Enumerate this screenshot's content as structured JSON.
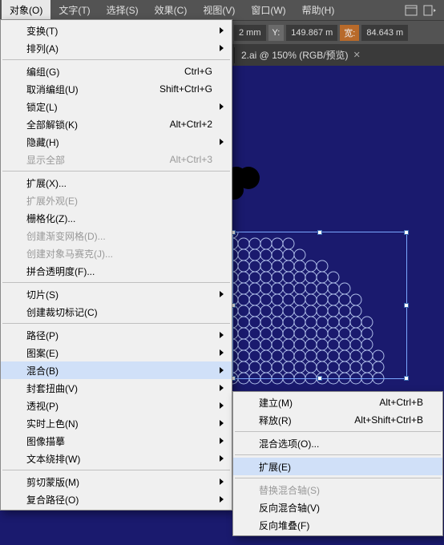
{
  "menubar": {
    "items": [
      "对象(O)",
      "文字(T)",
      "选择(S)",
      "效果(C)",
      "视图(V)",
      "窗口(W)",
      "帮助(H)"
    ]
  },
  "options": {
    "x_suffix": "2 mm",
    "y_label": "Y:",
    "y_value": "149.867 m",
    "w_label": "宽:",
    "w_value": "84.643 m"
  },
  "tab": {
    "title": "2.ai @ 150% (RGB/预览)"
  },
  "main_menu": [
    {
      "label": "变换(T)",
      "sub": true
    },
    {
      "label": "排列(A)",
      "sub": true
    },
    {
      "sep": true
    },
    {
      "label": "编组(G)",
      "shortcut": "Ctrl+G"
    },
    {
      "label": "取消编组(U)",
      "shortcut": "Shift+Ctrl+G"
    },
    {
      "label": "锁定(L)",
      "sub": true
    },
    {
      "label": "全部解锁(K)",
      "shortcut": "Alt+Ctrl+2"
    },
    {
      "label": "隐藏(H)",
      "sub": true
    },
    {
      "label": "显示全部",
      "shortcut": "Alt+Ctrl+3",
      "disabled": true
    },
    {
      "sep": true
    },
    {
      "label": "扩展(X)..."
    },
    {
      "label": "扩展外观(E)",
      "disabled": true
    },
    {
      "label": "栅格化(Z)..."
    },
    {
      "label": "创建渐变网格(D)...",
      "disabled": true
    },
    {
      "label": "创建对象马赛克(J)...",
      "disabled": true
    },
    {
      "label": "拼合透明度(F)..."
    },
    {
      "sep": true
    },
    {
      "label": "切片(S)",
      "sub": true
    },
    {
      "label": "创建裁切标记(C)"
    },
    {
      "sep": true
    },
    {
      "label": "路径(P)",
      "sub": true
    },
    {
      "label": "图案(E)",
      "sub": true
    },
    {
      "label": "混合(B)",
      "sub": true,
      "hi": true
    },
    {
      "label": "封套扭曲(V)",
      "sub": true
    },
    {
      "label": "透视(P)",
      "sub": true
    },
    {
      "label": "实时上色(N)",
      "sub": true
    },
    {
      "label": "图像描摹",
      "sub": true
    },
    {
      "label": "文本绕排(W)",
      "sub": true
    },
    {
      "sep": true
    },
    {
      "label": "剪切蒙版(M)",
      "sub": true
    },
    {
      "label": "复合路径(O)",
      "sub": true
    }
  ],
  "sub_menu": [
    {
      "label": "建立(M)",
      "shortcut": "Alt+Ctrl+B"
    },
    {
      "label": "释放(R)",
      "shortcut": "Alt+Shift+Ctrl+B"
    },
    {
      "sep": true
    },
    {
      "label": "混合选项(O)..."
    },
    {
      "sep": true
    },
    {
      "label": "扩展(E)",
      "hi": true
    },
    {
      "sep": true
    },
    {
      "label": "替换混合轴(S)",
      "disabled": true
    },
    {
      "label": "反向混合轴(V)"
    },
    {
      "label": "反向堆叠(F)"
    }
  ]
}
